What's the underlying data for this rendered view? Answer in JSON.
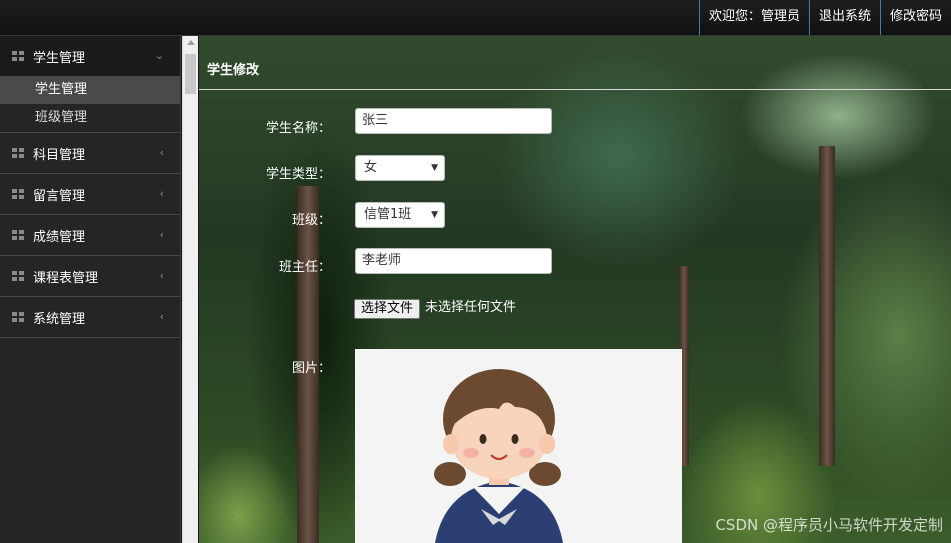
{
  "header": {
    "welcome_label": "欢迎您：管理员",
    "logout_label": "退出系统",
    "change_password_label": "修改密码"
  },
  "sidebar": {
    "groups": [
      {
        "label": "学生管理",
        "expanded": true,
        "items": [
          "学生管理",
          "班级管理"
        ],
        "active_item": "学生管理"
      },
      {
        "label": "科目管理",
        "expanded": false
      },
      {
        "label": "留言管理",
        "expanded": false
      },
      {
        "label": "成绩管理",
        "expanded": false
      },
      {
        "label": "课程表管理",
        "expanded": false
      },
      {
        "label": "系统管理",
        "expanded": false
      }
    ]
  },
  "main": {
    "section_title": "学生修改",
    "form": {
      "name_label": "学生名称：",
      "name_value": "张三",
      "type_label": "学生类型：",
      "type_value": "女",
      "class_label": "班级：",
      "class_value": "信管1班",
      "teacher_label": "班主任：",
      "teacher_value": "李老师",
      "file_button_label": "选择文件",
      "file_status": "未选择任何文件",
      "image_label": "图片："
    }
  },
  "watermark": "CSDN @程序员小马软件开发定制",
  "colors": {
    "topbar_bg": "#151515",
    "topbar_divider": "#3e7fb8",
    "sidebar_bg": "#252525",
    "active_item_bg": "#4a4a4a"
  }
}
